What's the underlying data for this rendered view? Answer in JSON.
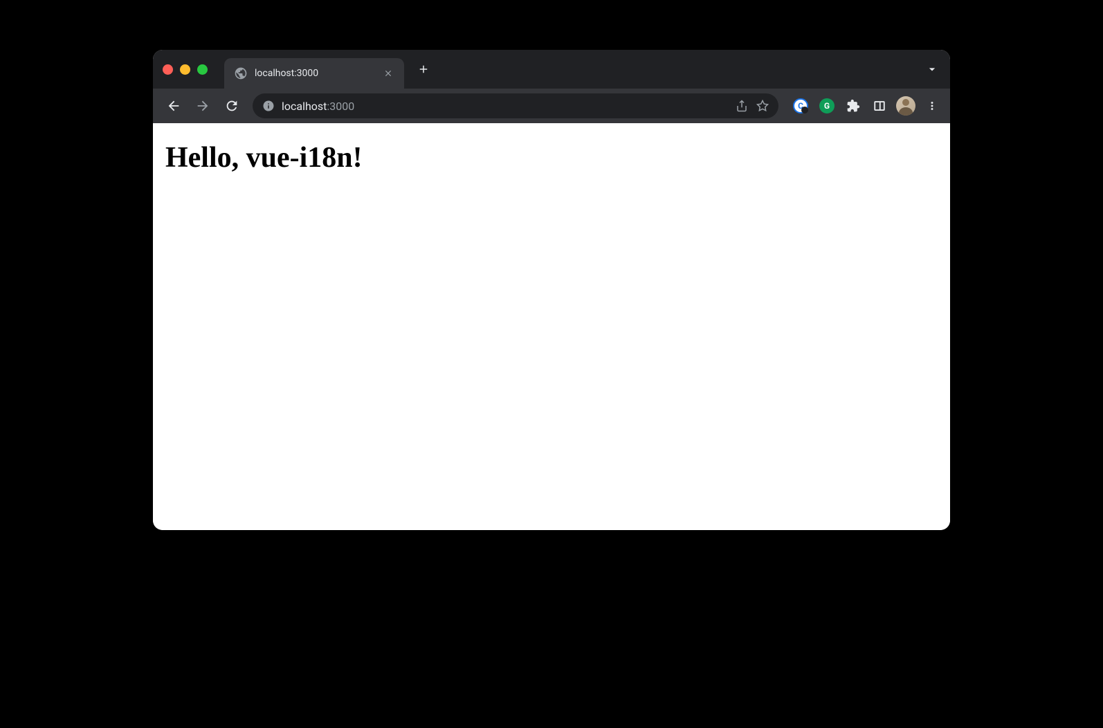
{
  "tab": {
    "title": "localhost:3000"
  },
  "address": {
    "host": "localhost",
    "port": ":3000"
  },
  "extensions": {
    "item1": "C",
    "item2": "G"
  },
  "page": {
    "heading": "Hello, vue-i18n!"
  }
}
